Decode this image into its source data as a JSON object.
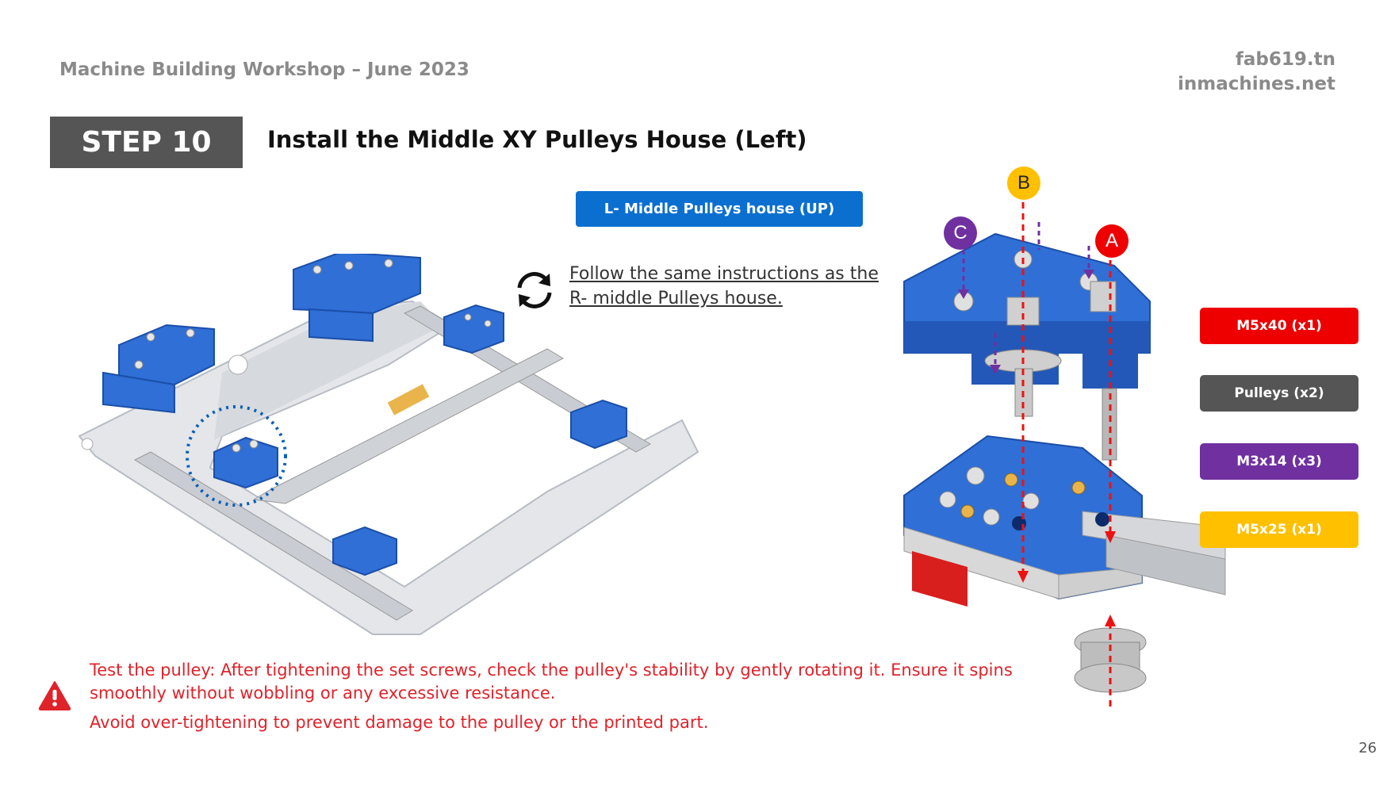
{
  "header": {
    "workshop": "Machine Building Workshop – June 2023",
    "site1": "fab619.tn",
    "site2": "inmachines.net"
  },
  "step": {
    "label": "STEP 10",
    "title": "Install the Middle XY Pulleys House (Left)"
  },
  "part_label": "L- Middle Pulleys house (UP)",
  "instruction": {
    "line1": "Follow the same instructions as the",
    "line2": "R- middle Pulleys house."
  },
  "callouts": {
    "a": "A",
    "b": "B",
    "c": "C"
  },
  "parts": [
    {
      "label": "M5x40 (x1)",
      "color": "#ee0000"
    },
    {
      "label": "Pulleys (x2)",
      "color": "#555555"
    },
    {
      "label": "M3x14 (x3)",
      "color": "#7030a0"
    },
    {
      "label": "M5x25 (x1)",
      "color": "#ffc000"
    }
  ],
  "warning": {
    "line1": "Test the pulley: After tightening the set screws, check the pulley's stability by gently rotating it. Ensure it spins smoothly without wobbling or any excessive resistance.",
    "line2": "Avoid over-tightening to prevent damage to the pulley or the printed part."
  },
  "page_number": "26",
  "colors": {
    "accent_blue": "#0b6fd0",
    "part_blue": "#2f6fd6",
    "warning_red": "#e0222a"
  }
}
